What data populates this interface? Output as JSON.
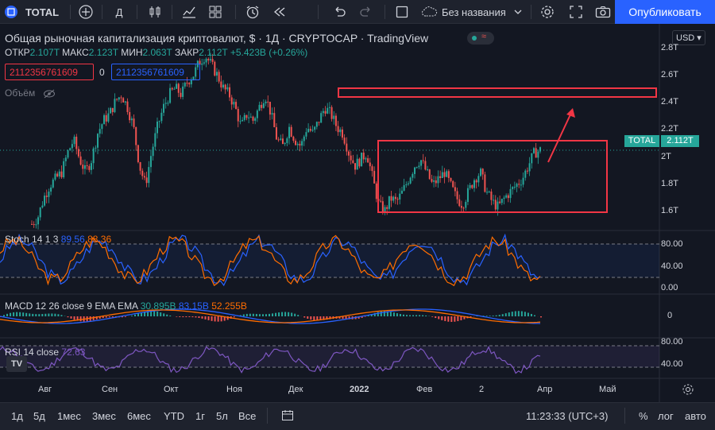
{
  "toolbar": {
    "symbol": "TOTAL",
    "interval": "Д",
    "layout_name": "Без названия",
    "publish": "Опубликовать"
  },
  "legend": {
    "title": "Общая рыночная капитализация криптовалют, $ · 1Д · CRYPTOCAP · TradingView",
    "open_label": "ОТКР",
    "open": "2.107T",
    "high_label": "МАКС",
    "high": "2.123T",
    "low_label": "МИН",
    "low": "2.063T",
    "close_label": "ЗАКР",
    "close": "2.112T",
    "change": "+5.423B (+0.26%)",
    "sell_price": "2112356761609",
    "mid_value": "0",
    "buy_price": "2112356761609",
    "volume": "Объём"
  },
  "price_axis": {
    "currency": "USD",
    "ticks": [
      "2.8T",
      "2.6T",
      "2.4T",
      "2.2T",
      "2T",
      "1.8T",
      "1.6T"
    ],
    "current_label": "TOTAL",
    "current_value": "2.112T"
  },
  "stoch": {
    "label": "Stoch 14 1 3",
    "k": "89.56",
    "d": "88.36",
    "ticks": [
      "80.00",
      "40.00",
      "0.00"
    ]
  },
  "macd": {
    "label": "MACD 12 26 close 9 EMA EMA",
    "hist": "30.895B",
    "macd": "83.15B",
    "signal": "52.255B",
    "ticks": [
      "0"
    ]
  },
  "rsi": {
    "label": "RSI 14 close",
    "value": "72.63",
    "ticks": [
      "80.00",
      "40.00"
    ]
  },
  "time_axis": [
    "Авг",
    "Сен",
    "Окт",
    "Ноя",
    "Дек",
    "2022",
    "Фев",
    "2",
    "Апр",
    "Май"
  ],
  "bottom": {
    "ranges": [
      "1д",
      "5д",
      "1мес",
      "3мес",
      "6мес",
      "YTD",
      "1г",
      "5л",
      "Все"
    ],
    "time": "11:23:33 (UTC+3)",
    "percent": "%",
    "log": "лог",
    "auto": "авто"
  },
  "colors": {
    "up": "#26a69a",
    "down": "#ef5350",
    "annotation": "#f23645",
    "macd": "#2962ff",
    "signal": "#ff6d00",
    "rsi": "#7e57c2",
    "stoch_k": "#2962ff",
    "stoch_d": "#ff6d00"
  },
  "chart_data": {
    "type": "candlestick",
    "title": "Общая рыночная капитализация криптовалют, $",
    "ylabel": "USD",
    "ylim": [
      1.5,
      2.85
    ],
    "x_labels": [
      "Авг",
      "Сен",
      "Окт",
      "Ноя",
      "Дек",
      "2022",
      "Фев",
      "2",
      "Апр",
      "Май"
    ],
    "price_path": [
      1.55,
      1.6,
      1.75,
      1.85,
      1.9,
      1.95,
      2.1,
      2.2,
      2.05,
      1.95,
      2.05,
      2.25,
      2.35,
      2.4,
      2.5,
      2.55,
      2.45,
      2.3,
      2.0,
      1.85,
      2.1,
      2.3,
      2.45,
      2.55,
      2.6,
      2.55,
      2.65,
      2.7,
      2.8,
      2.85,
      2.78,
      2.7,
      2.6,
      2.55,
      2.45,
      2.3,
      2.4,
      2.35,
      2.45,
      2.55,
      2.4,
      2.2,
      2.15,
      2.3,
      2.2,
      2.15,
      2.3,
      2.25,
      2.35,
      2.45,
      2.4,
      2.3,
      2.25,
      2.1,
      2.0,
      2.05,
      2.1,
      1.9,
      1.7,
      1.65,
      1.75,
      1.72,
      1.8,
      1.9,
      2.0,
      2.05,
      1.95,
      1.85,
      1.9,
      1.95,
      1.85,
      1.75,
      1.7,
      1.8,
      1.9,
      1.95,
      1.8,
      1.72,
      1.68,
      1.75,
      1.8,
      1.85,
      1.9,
      2.0,
      2.1,
      2.12
    ]
  }
}
